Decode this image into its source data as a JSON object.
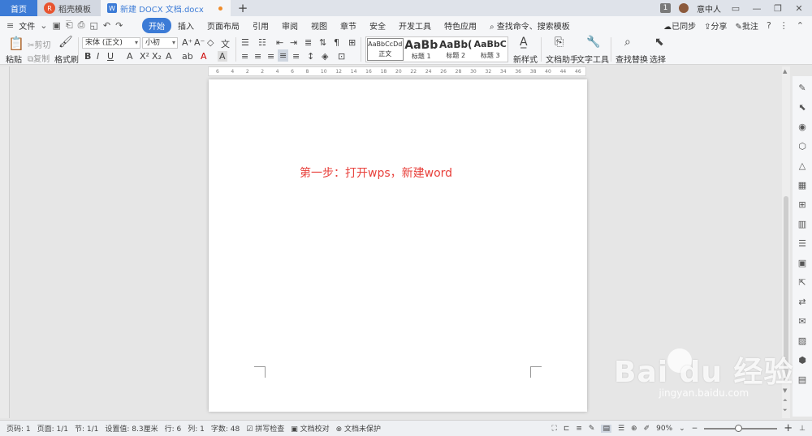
{
  "tabs": {
    "home": "首页",
    "template": "稻壳模板",
    "document": "新建 DOCX 文档.docx",
    "add": "+"
  },
  "titlebar": {
    "badge": "1",
    "user": "意中人"
  },
  "menu": {
    "file": "文件",
    "items": [
      "开始",
      "插入",
      "页面布局",
      "引用",
      "审阅",
      "视图",
      "章节",
      "安全",
      "开发工具",
      "特色应用"
    ],
    "search": "查找命令、搜索模板",
    "sync": "已同步",
    "share": "分享",
    "comment": "批注"
  },
  "ribbon": {
    "paste": "粘贴",
    "cut": "剪切",
    "copy": "复制",
    "format_painter": "格式刷",
    "font_name": "宋体 (正文)",
    "font_size": "小初",
    "styles": [
      {
        "preview": "AaBbCcDd",
        "label": "正文"
      },
      {
        "preview": "AaBb",
        "label": "标题 1"
      },
      {
        "preview": "AaBb(",
        "label": "标题 2"
      },
      {
        "preview": "AaBbC",
        "label": "标题 3"
      }
    ],
    "new_style": "新样式",
    "doc_helper": "文档助手",
    "text_tools": "文字工具",
    "find_replace": "查找替换",
    "select": "选择"
  },
  "ruler": [
    "6",
    "4",
    "2",
    "2",
    "4",
    "6",
    "8",
    "10",
    "12",
    "14",
    "16",
    "18",
    "20",
    "22",
    "24",
    "26",
    "28",
    "30",
    "32",
    "34",
    "36",
    "38",
    "40",
    "44",
    "46"
  ],
  "document": {
    "text": "第一步：打开wps，新建word"
  },
  "status": {
    "page_num": "页码: 1",
    "pages": "页面: 1/1",
    "section": "节: 1/1",
    "setting": "设置值: 8.3厘米",
    "row": "行: 6",
    "col": "列: 1",
    "words": "字数: 48",
    "spell": "拼写检查",
    "proof": "文档校对",
    "protect": "文档未保护",
    "zoom": "90%"
  },
  "watermark": {
    "logo": "Bai du 经验",
    "url": "jingyan.baidu.com"
  }
}
